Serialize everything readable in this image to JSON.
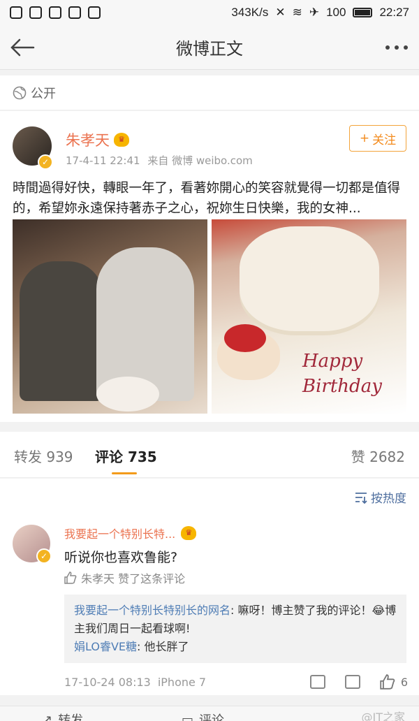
{
  "status_bar": {
    "speed": "343K/s",
    "battery": "100",
    "time": "22:27"
  },
  "nav": {
    "title": "微博正文"
  },
  "privacy": {
    "label": "公开"
  },
  "post": {
    "author": "朱孝天",
    "date": "17-4-11 22:41",
    "source": "来自 微博 weibo.com",
    "follow_label": "关注",
    "text": "時間過得好快，轉眼一年了，看著妳開心的笑容就覺得一切都是值得的，希望妳永遠保持著赤子之心，祝妳生日快樂，我的女神...",
    "photo_caption": [
      "Happy",
      "Birthday"
    ]
  },
  "tabs": {
    "repost_label": "转发",
    "repost_count": "939",
    "comment_label": "评论",
    "comment_count": "735",
    "like_label": "赞",
    "like_count": "2682"
  },
  "comments": {
    "sort_label": "按热度",
    "first": {
      "user": "我要起一个特别长特...",
      "text": "听说你也喜欢鲁能?",
      "liked_by": "朱孝天 赞了这条评论",
      "replies": [
        {
          "user": "我要起一个特别长特别长的网名",
          "text": ": 嘛呀！博主赞了我的评论！😂博主我们周日一起看球啊!"
        },
        {
          "user": "娟LO睿VE糖",
          "text": ": 他长胖了"
        }
      ],
      "time": "17-10-24 08:13",
      "device": "iPhone 7",
      "like_count": "6"
    }
  },
  "bottom_bar": {
    "repost": "转发",
    "comment": "评论",
    "watermark": "@IT之家"
  }
}
